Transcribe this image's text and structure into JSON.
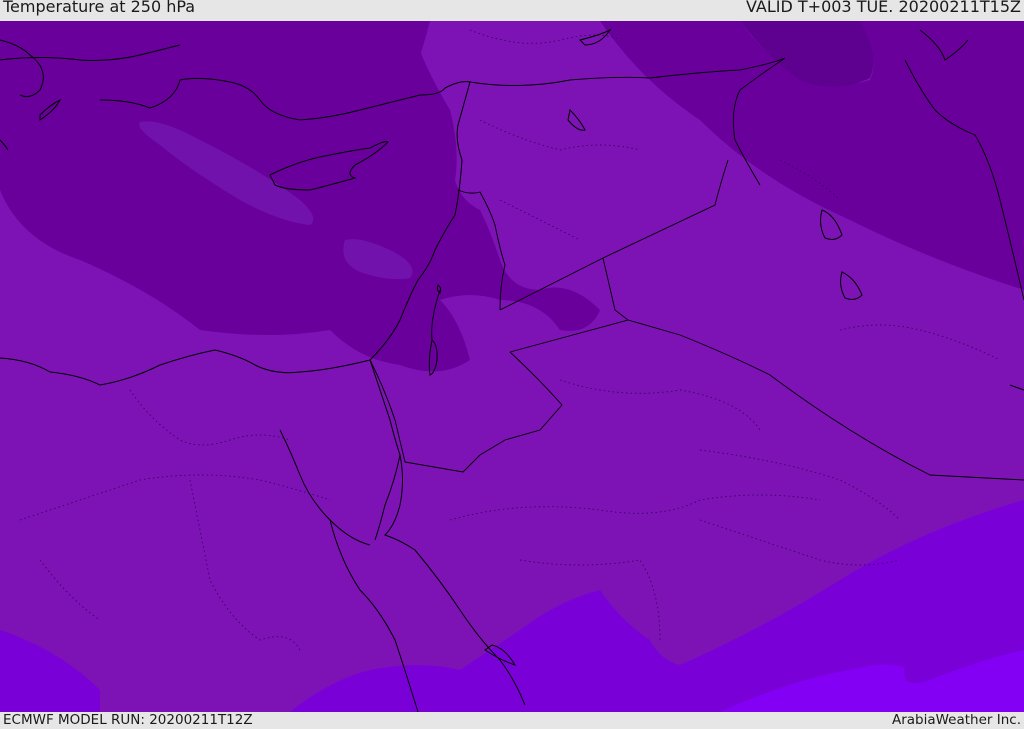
{
  "header": {
    "title": "Temperature at 250 hPa",
    "valid": "VALID T+003 TUE. 20200211T15Z"
  },
  "footer": {
    "model_run": "ECMWF MODEL RUN: 20200211T12Z",
    "credit": "ArabiaWeather Inc."
  },
  "colors": {
    "coldest": "#5e0090",
    "colder": "#69009c",
    "cold": "#7212ad",
    "mid": "#7d13b4",
    "warm": "#7a00d8",
    "warmest": "#8300f5",
    "coastline": "#000000"
  }
}
